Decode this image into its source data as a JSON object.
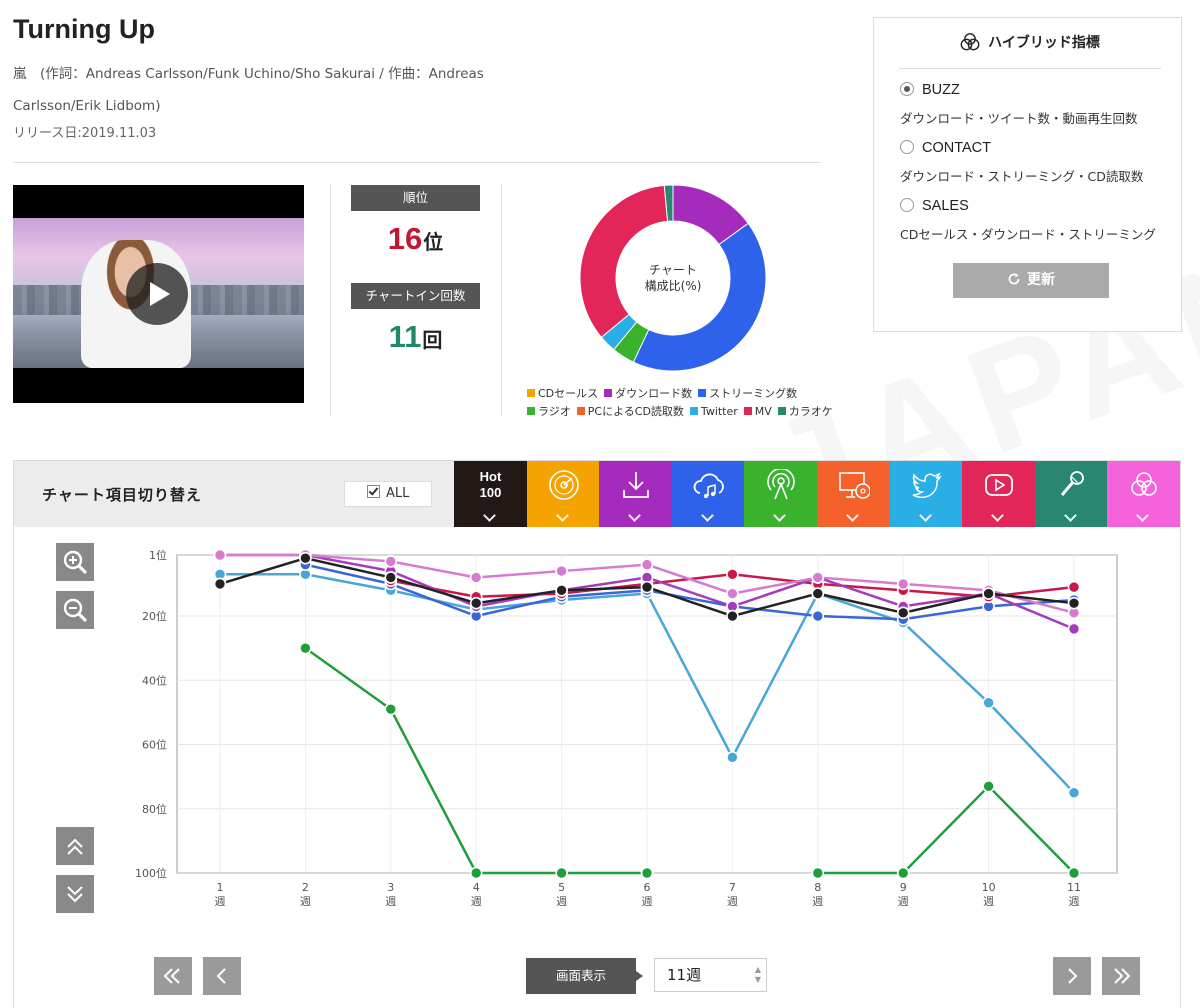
{
  "song": {
    "title": "Turning Up",
    "credits": "嵐　(作詞：Andreas Carlsson/Funk Uchino/Sho Sakurai / 作曲：Andreas Carlsson/Erik Lidbom)",
    "release": "リリース日:2019.11.03"
  },
  "stats": {
    "rank_label": "順位",
    "rank_value": "16",
    "rank_unit": "位",
    "chartin_label": "チャートイン回数",
    "chartin_value": "11",
    "chartin_unit": "回"
  },
  "composition": {
    "center_line1": "チャート",
    "center_line2": "構成比(%)",
    "legend": [
      {
        "label": "CDセールス",
        "color": "#f5a300"
      },
      {
        "label": "ダウンロード数",
        "color": "#a52bbd"
      },
      {
        "label": "ストリーミング数",
        "color": "#2e62ea"
      },
      {
        "label": "ラジオ",
        "color": "#3ab22d"
      },
      {
        "label": "PCによるCD読取数",
        "color": "#f4612a"
      },
      {
        "label": "Twitter",
        "color": "#2aaee6"
      },
      {
        "label": "MV",
        "color": "#e3265a"
      },
      {
        "label": "カラオケ",
        "color": "#28876e"
      }
    ],
    "slices": [
      {
        "name": "CDセールス",
        "value": 0
      },
      {
        "name": "ダウンロード数",
        "value": 15
      },
      {
        "name": "ストリーミング数",
        "value": 42
      },
      {
        "name": "ラジオ",
        "value": 4
      },
      {
        "name": "PCによるCD読取数",
        "value": 0
      },
      {
        "name": "Twitter",
        "value": 3
      },
      {
        "name": "MV",
        "value": 34.5
      },
      {
        "name": "カラオケ",
        "value": 1.5
      }
    ]
  },
  "hybrid": {
    "title": "ハイブリッド指標",
    "options": [
      {
        "label": "BUZZ",
        "desc": "ダウンロード・ツイート数・動画再生回数",
        "selected": true
      },
      {
        "label": "CONTACT",
        "desc": "ダウンロード・ストリーミング・CD読取数",
        "selected": false
      },
      {
        "label": "SALES",
        "desc": "CDセールス・ダウンロード・ストリーミング",
        "selected": false
      }
    ],
    "update_label": "更新"
  },
  "switcher": {
    "label": "チャート項目切り替え",
    "all_label": "ALL",
    "tabs": [
      {
        "name": "hot100",
        "hot": "Hot",
        "hot2": "100",
        "color": "#221816",
        "icon": "hot100"
      },
      {
        "name": "cd-sales",
        "color": "#f5a300",
        "icon": "disc-icon"
      },
      {
        "name": "download",
        "color": "#a52bbd",
        "icon": "download-icon"
      },
      {
        "name": "streaming",
        "color": "#2e62ea",
        "icon": "cloud-music-icon"
      },
      {
        "name": "radio",
        "color": "#3ab22d",
        "icon": "radio-icon"
      },
      {
        "name": "pc-cd-read",
        "color": "#f4612a",
        "icon": "pc-disc-icon"
      },
      {
        "name": "twitter",
        "color": "#2aaee6",
        "icon": "twitter-icon"
      },
      {
        "name": "mv",
        "color": "#e3265a",
        "icon": "play-icon"
      },
      {
        "name": "karaoke",
        "color": "#28876e",
        "icon": "mic-icon"
      },
      {
        "name": "hybrid",
        "color": "#f463da",
        "icon": "hybrid-icon"
      }
    ]
  },
  "footer": {
    "display_label": "画面表示",
    "week_select": "11週"
  },
  "chart_data": {
    "type": "line",
    "categories": [
      "1\n週",
      "2\n週",
      "3\n週",
      "4\n週",
      "5\n週",
      "6\n週",
      "7\n週",
      "8\n週",
      "9\n週",
      "10\n週",
      "11\n週"
    ],
    "y_ticks": [
      "1位",
      "20位",
      "40位",
      "60位",
      "80位",
      "100位"
    ],
    "y_tick_values": [
      1,
      20,
      40,
      60,
      80,
      100
    ],
    "ylim": [
      1,
      100
    ],
    "y_inverted": true,
    "grid": true,
    "series": [
      {
        "color": "#1f9e3c",
        "values": [
          null,
          30,
          49,
          100,
          100,
          100,
          null,
          100,
          100,
          73,
          100
        ]
      },
      {
        "color": "#4aa6d6",
        "values": [
          7,
          7,
          12,
          18,
          15,
          13,
          64,
          13,
          22,
          47,
          75
        ]
      },
      {
        "color": "#3a66d6",
        "values": [
          null,
          4,
          10,
          20,
          14,
          12,
          17,
          20,
          21,
          17,
          15
        ]
      },
      {
        "color": "#c9174a",
        "values": [
          null,
          null,
          9,
          14,
          13,
          10,
          7,
          10,
          12,
          14,
          11
        ]
      },
      {
        "color": "#a33bbd",
        "values": [
          1,
          1,
          6,
          17,
          12,
          8,
          17,
          8,
          17,
          13,
          24
        ]
      },
      {
        "color": "#d77ad2",
        "values": [
          1,
          1,
          3,
          8,
          6,
          4,
          13,
          8,
          10,
          12,
          19
        ]
      },
      {
        "color": "#222222",
        "values": [
          10,
          2,
          8,
          16,
          12,
          11,
          20,
          13,
          19,
          13,
          16
        ]
      }
    ]
  }
}
